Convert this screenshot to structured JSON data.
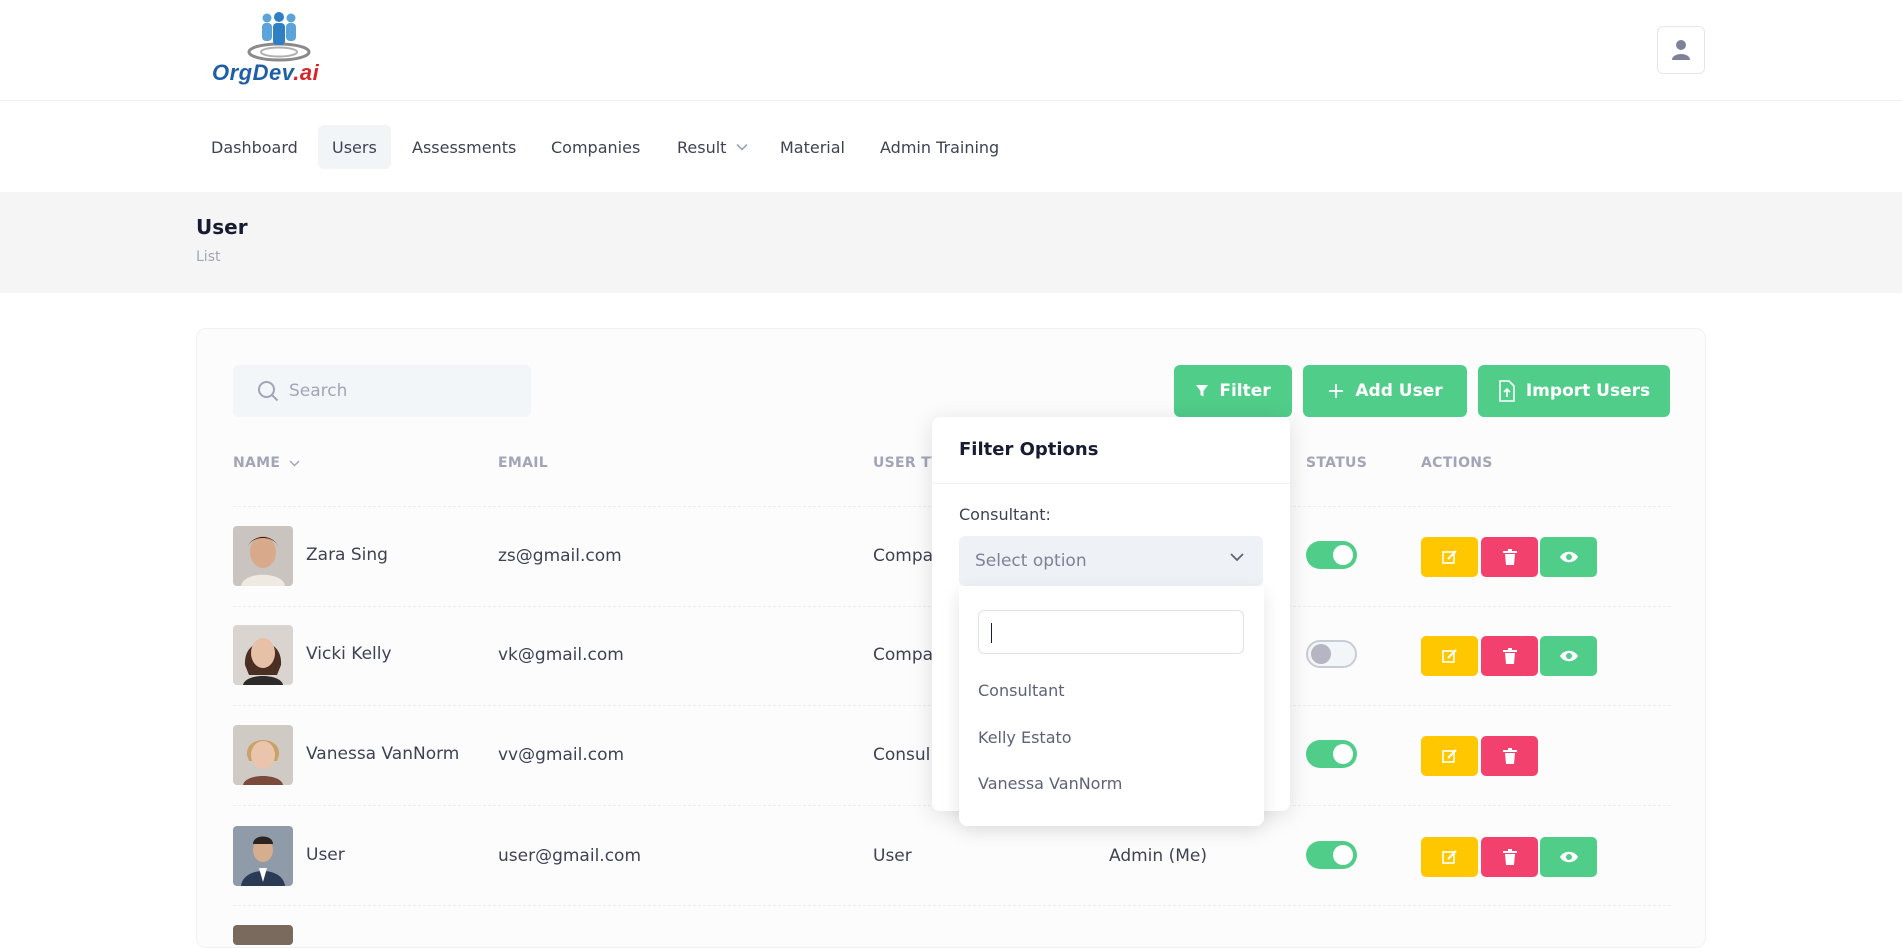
{
  "app": {
    "logo_text_main": "OrgDev",
    "logo_text_suffix": ".ai"
  },
  "nav": {
    "items": [
      {
        "label": "Dashboard"
      },
      {
        "label": "Users"
      },
      {
        "label": "Assessments"
      },
      {
        "label": "Companies"
      },
      {
        "label": "Result"
      },
      {
        "label": "Material"
      },
      {
        "label": "Admin Training"
      }
    ],
    "active": "Users"
  },
  "page": {
    "title": "User",
    "subtitle": "List"
  },
  "toolbar": {
    "search_placeholder": "Search",
    "filter_label": "Filter",
    "add_user_label": "Add User",
    "import_users_label": "Import Users"
  },
  "table": {
    "headers": {
      "name": "NAME",
      "email": "EMAIL",
      "user_type": "USER TY",
      "status": "STATUS",
      "actions": "ACTIONS"
    },
    "rows": [
      {
        "name": "Zara Sing",
        "email": "zs@gmail.com",
        "user_type": "Compa",
        "company": "",
        "status": true,
        "has_view": true
      },
      {
        "name": "Vicki Kelly",
        "email": "vk@gmail.com",
        "user_type": "Compa",
        "company": "",
        "status": false,
        "has_view": true
      },
      {
        "name": "Vanessa VanNorm",
        "email": "vv@gmail.com",
        "user_type": "Consul",
        "company": "",
        "status": true,
        "has_view": false
      },
      {
        "name": "User",
        "email": "user@gmail.com",
        "user_type": "User",
        "company": "Admin (Me)",
        "status": true,
        "has_view": true
      }
    ]
  },
  "filter_panel": {
    "title": "Filter Options",
    "consultant_label": "Consultant:",
    "select_placeholder": "Select option",
    "search_value": "",
    "options": [
      "Consultant",
      "Kelly Estato",
      "Vanessa VanNorm"
    ]
  },
  "colors": {
    "green": "#50cd89",
    "yellow": "#ffc700",
    "red": "#f1416c"
  },
  "icons": {
    "search": "search-icon",
    "filter": "filter-icon",
    "add": "plus-icon",
    "import": "file-upload-icon",
    "edit": "edit-icon",
    "delete": "trash-icon",
    "view": "eye-icon",
    "user": "user-icon",
    "chevron": "chevron-down-icon"
  }
}
